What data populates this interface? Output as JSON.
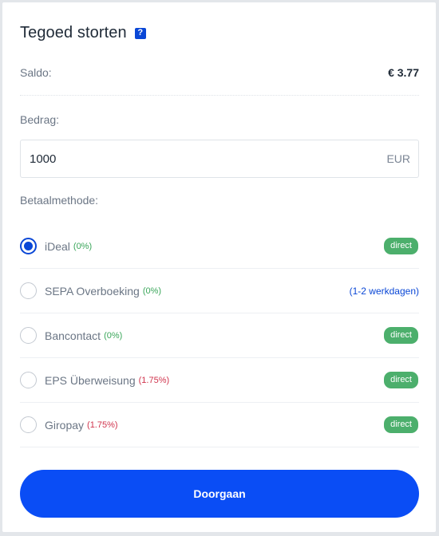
{
  "header": {
    "title": "Tegoed storten",
    "help_glyph": "?"
  },
  "balance": {
    "label": "Saldo:",
    "value": "€ 3.77"
  },
  "amount": {
    "label": "Bedrag:",
    "value": "1000",
    "currency": "EUR"
  },
  "payment": {
    "label": "Betaalmethode:",
    "methods": [
      {
        "name": "iDeal",
        "fee": "(0%)",
        "fee_color": "green",
        "speed": "direct",
        "speed_style": "badge",
        "selected": true
      },
      {
        "name": "SEPA Overboeking",
        "fee": "(0%)",
        "fee_color": "green",
        "speed": "(1-2 werkdagen)",
        "speed_style": "text",
        "selected": false
      },
      {
        "name": "Bancontact",
        "fee": "(0%)",
        "fee_color": "green",
        "speed": "direct",
        "speed_style": "badge",
        "selected": false
      },
      {
        "name": "EPS Überweisung",
        "fee": "(1.75%)",
        "fee_color": "red",
        "speed": "direct",
        "speed_style": "badge",
        "selected": false
      },
      {
        "name": "Giropay",
        "fee": "(1.75%)",
        "fee_color": "red",
        "speed": "direct",
        "speed_style": "badge",
        "selected": false
      }
    ]
  },
  "submit": {
    "label": "Doorgaan"
  },
  "colors": {
    "accent": "#0a4df5",
    "badge": "#4caf6c",
    "fee_free": "#3aa65a",
    "fee_paid": "#d0344d"
  }
}
